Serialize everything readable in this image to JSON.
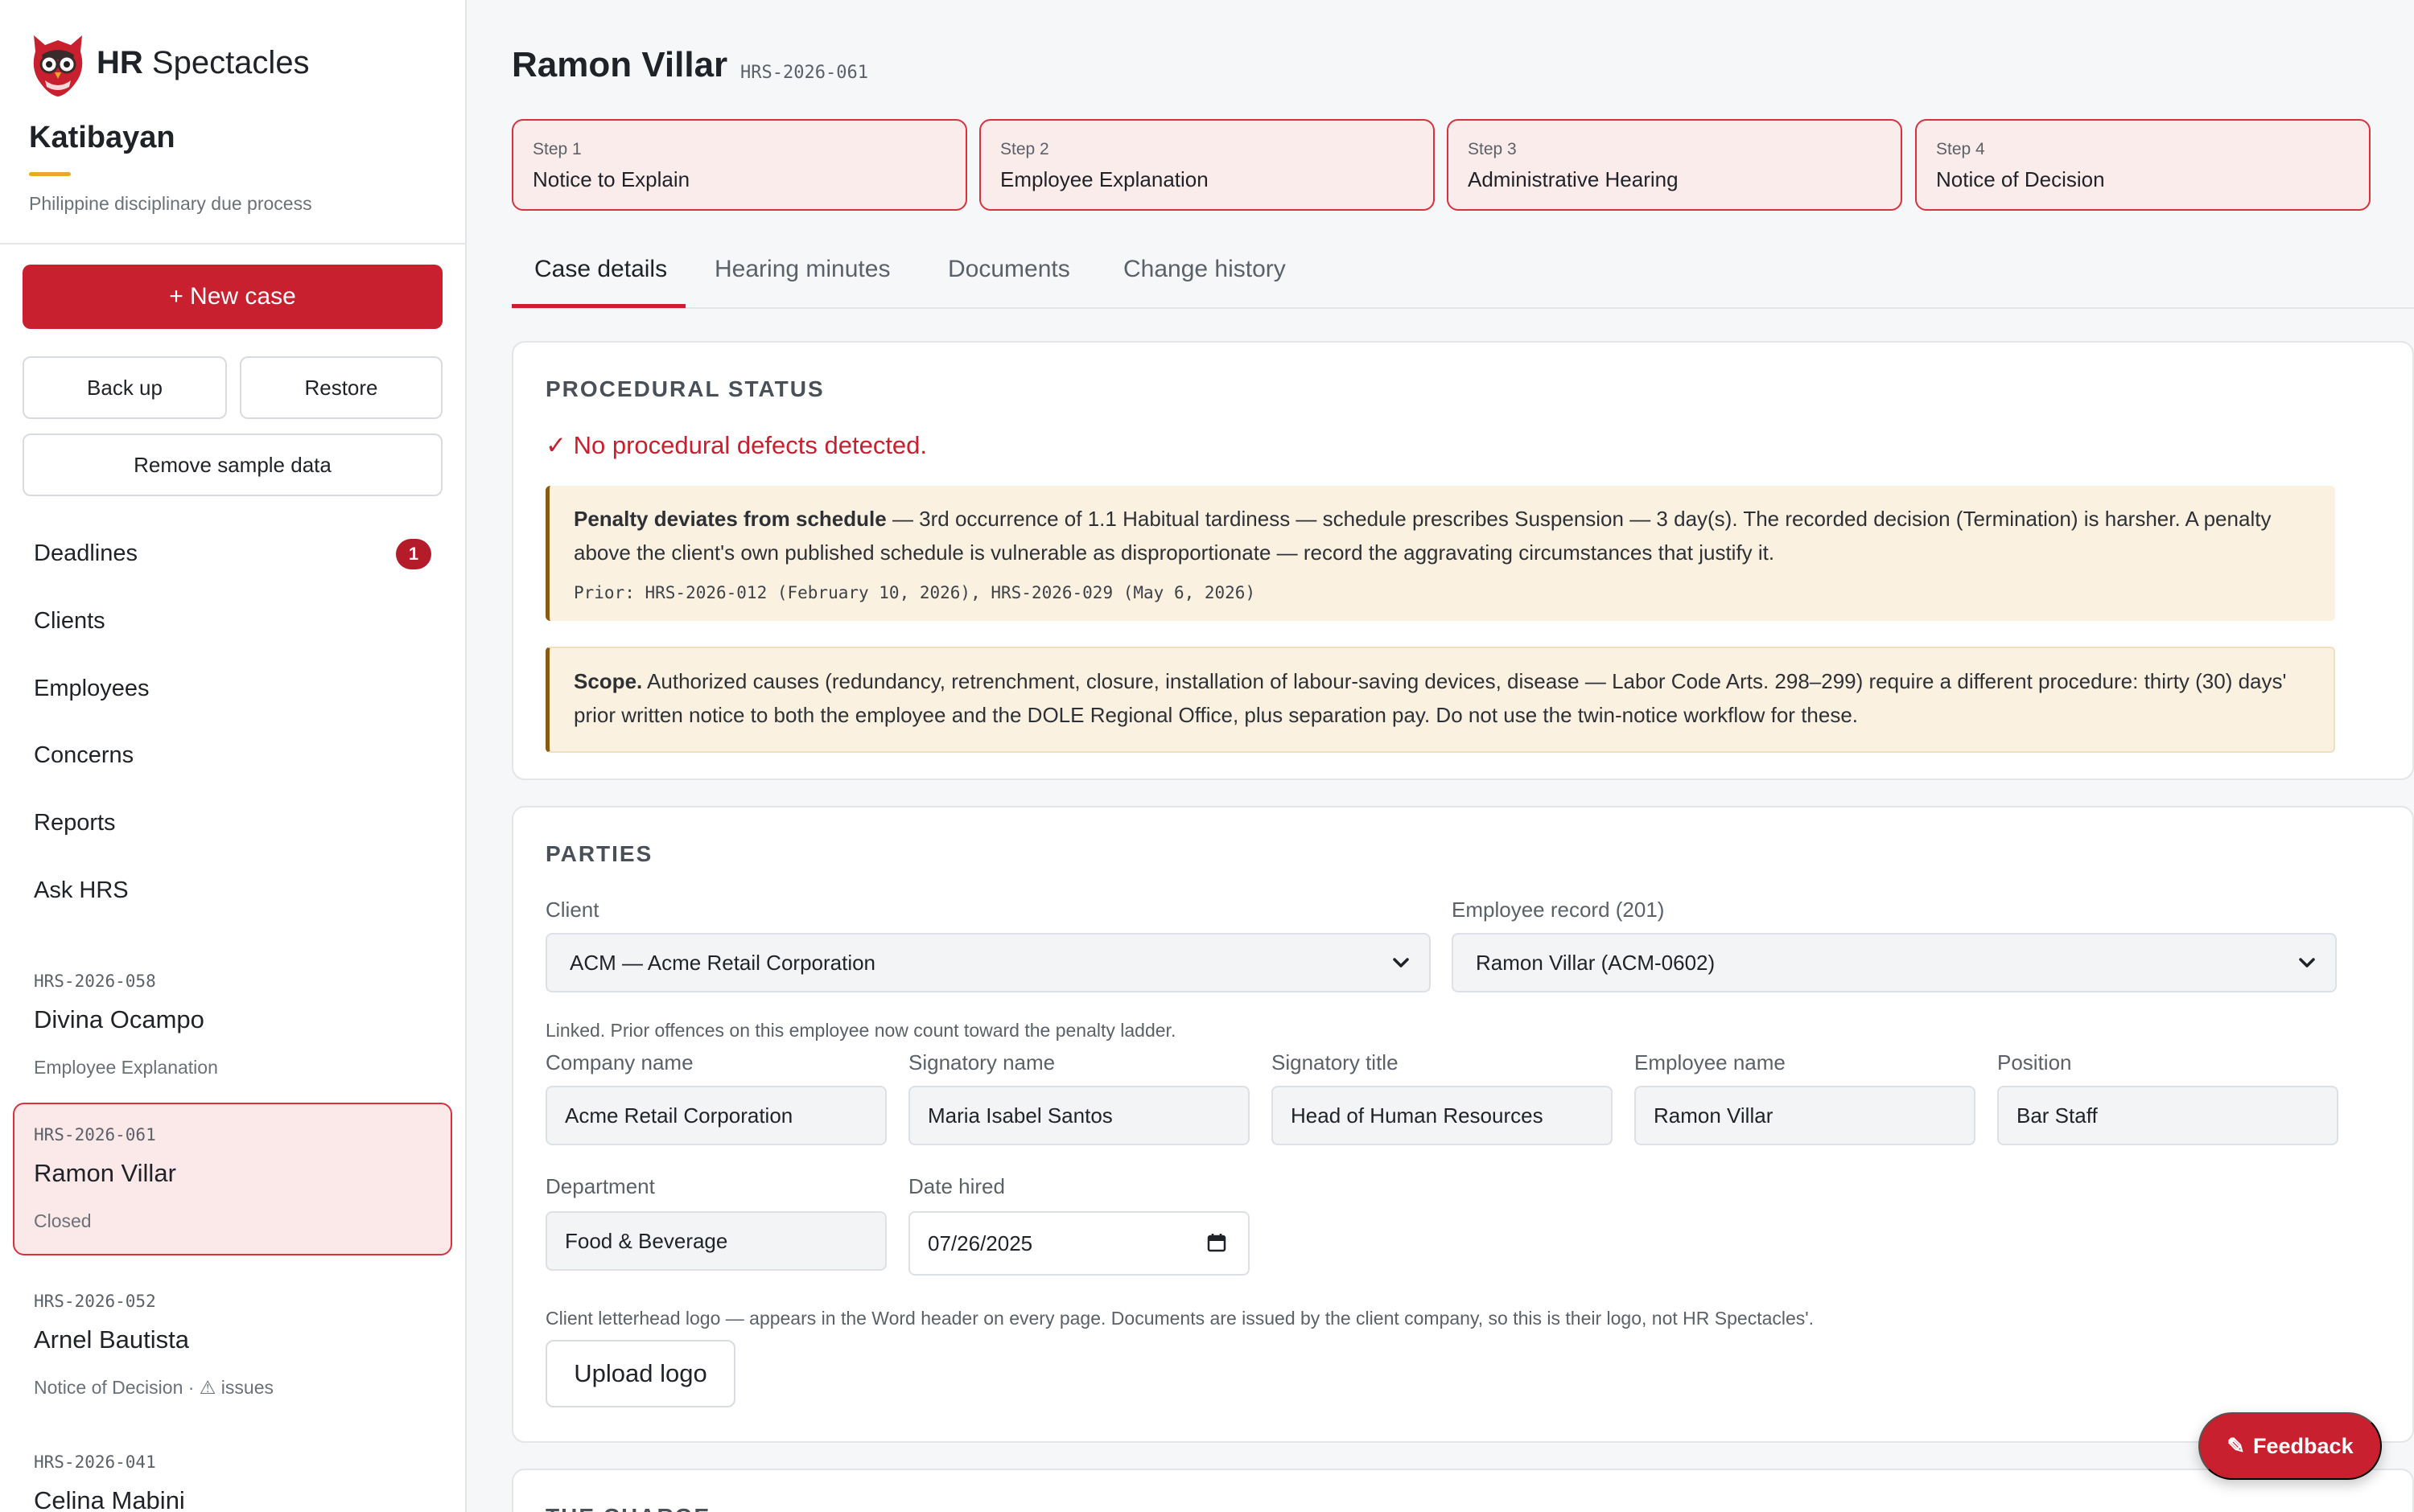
{
  "sidebar": {
    "brand_bold": "HR",
    "brand_rest": " Spectacles",
    "app_name": "Katibayan",
    "app_subtitle": "Philippine disciplinary due process",
    "new_case_label": "+ New case",
    "backup_label": "Back up",
    "restore_label": "Restore",
    "remove_sample_label": "Remove sample data",
    "nav": [
      {
        "label": "Deadlines",
        "badge": "1"
      },
      {
        "label": "Clients"
      },
      {
        "label": "Employees"
      },
      {
        "label": "Concerns"
      },
      {
        "label": "Reports"
      },
      {
        "label": "Ask HRS"
      }
    ],
    "cases": [
      {
        "code": "HRS-2026-058",
        "name": "Divina Ocampo",
        "status": "Employee Explanation"
      },
      {
        "code": "HRS-2026-061",
        "name": "Ramon Villar",
        "status": "Closed"
      },
      {
        "code": "HRS-2026-052",
        "name": "Arnel Bautista",
        "status": "Notice of Decision · ⚠ issues"
      },
      {
        "code": "HRS-2026-041",
        "name": "Celina Mabini",
        "status": ""
      }
    ]
  },
  "header": {
    "title": "Ramon Villar",
    "code": "HRS-2026-061"
  },
  "steps": [
    {
      "num": "Step 1",
      "label": "Notice to Explain"
    },
    {
      "num": "Step 2",
      "label": "Employee Explanation"
    },
    {
      "num": "Step 3",
      "label": "Administrative Hearing"
    },
    {
      "num": "Step 4",
      "label": "Notice of Decision"
    }
  ],
  "tabs": [
    "Case details",
    "Hearing minutes",
    "Documents",
    "Change history"
  ],
  "procedural": {
    "title": "PROCEDURAL STATUS",
    "ok": "✓ No procedural defects detected.",
    "penalty_bold": "Penalty deviates from schedule",
    "penalty_text": " — 3rd occurrence of 1.1 Habitual tardiness — schedule prescribes Suspension — 3 day(s). The recorded decision (Termination) is harsher. A penalty above the client's own published schedule is vulnerable as disproportionate — record the aggravating circumstances that justify it.",
    "penalty_prior": "Prior: HRS-2026-012 (February 10, 2026), HRS-2026-029 (May 6, 2026)",
    "scope_bold": "Scope.",
    "scope_text": " Authorized causes (redundancy, retrenchment, closure, installation of labour-saving devices, disease — Labor Code Arts. 298–299) require a different procedure: thirty (30) days' prior written notice to both the employee and the DOLE Regional Office, plus separation pay. Do not use the twin-notice workflow for these."
  },
  "parties": {
    "title": "PARTIES",
    "client_label": "Client",
    "client_value": "ACM — Acme Retail Corporation",
    "employee_label": "Employee record (201)",
    "employee_value": "Ramon Villar (ACM-0602)",
    "linked_note": "Linked. Prior offences on this employee now count toward the penalty ladder.",
    "company_label": "Company name",
    "company_value": "Acme Retail Corporation",
    "signatory_label": "Signatory name",
    "signatory_value": "Maria Isabel Santos",
    "sigtitle_label": "Signatory title",
    "sigtitle_value": "Head of Human Resources",
    "empname_label": "Employee name",
    "empname_value": "Ramon Villar",
    "position_label": "Position",
    "position_value": "Bar Staff",
    "department_label": "Department",
    "department_value": "Food & Beverage",
    "hired_label": "Date hired",
    "hired_value": "07/26/2025",
    "logo_note": "Client letterhead logo — appears in the Word header on every page. Documents are issued by the client company, so this is their logo, not HR Spectacles'.",
    "upload_label": "Upload logo"
  },
  "next_section_title": "THE CHARGE",
  "feedback_label": "Feedback",
  "colors": {
    "accent": "#c8202e",
    "callout_bg": "#fbf1e1",
    "step_bg": "#fbecec",
    "brand_gold": "#e9a829"
  }
}
